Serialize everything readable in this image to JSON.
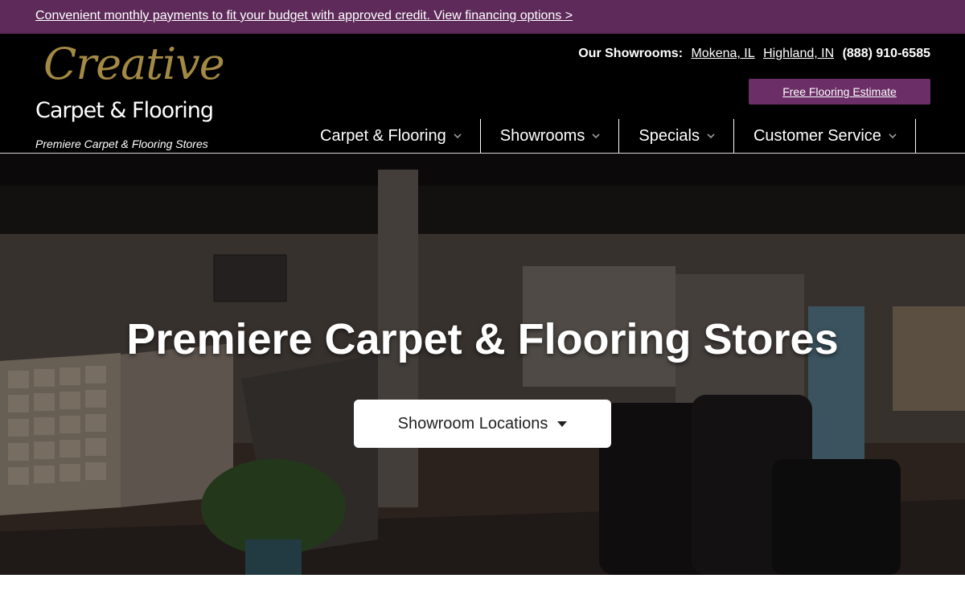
{
  "promo": {
    "text": "Convenient monthly payments to fit your budget with approved credit. View financing options >"
  },
  "logo": {
    "script": "Creative",
    "wordmark": "Carpet & Flooring",
    "tagline": "Premiere Carpet & Flooring Stores"
  },
  "showrooms": {
    "label": "Our Showrooms:",
    "locations": [
      "Mokena, IL",
      "Highland, IN"
    ],
    "phone": "(888) 910-6585"
  },
  "estimate_button": "Free Flooring Estimate",
  "nav": {
    "items": [
      {
        "label": "Carpet & Flooring",
        "icon": "chevron-down-icon"
      },
      {
        "label": "Showrooms",
        "icon": "chevron-down-icon"
      },
      {
        "label": "Specials",
        "icon": "chevron-down-icon"
      },
      {
        "label": "Customer Service",
        "icon": "chevron-down-icon"
      }
    ]
  },
  "hero": {
    "title": "Premiere Carpet & Flooring Stores",
    "button_label": "Showroom Locations",
    "button_icon": "caret-down-icon"
  },
  "colors": {
    "promo_bg": "#5e2a5a",
    "header_bg": "#000000",
    "estimate_bg": "#6b2e66",
    "logo_gold": "#a38a44"
  }
}
